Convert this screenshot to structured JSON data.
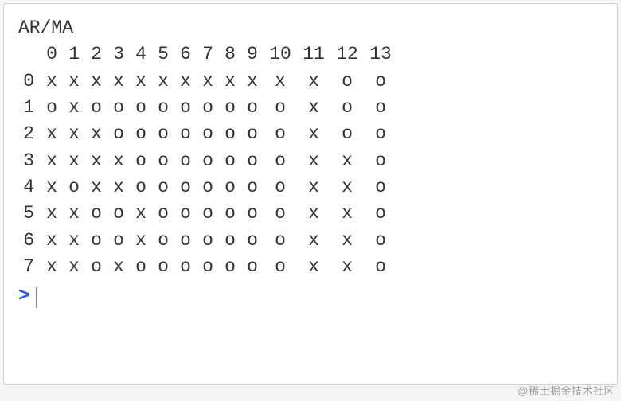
{
  "console": {
    "title": "AR/MA",
    "col_headers": [
      "0",
      "1",
      "2",
      "3",
      "4",
      "5",
      "6",
      "7",
      "8",
      "9",
      "10",
      "11",
      "12",
      "13"
    ],
    "rows": [
      {
        "label": "0",
        "cells": [
          "x",
          "x",
          "x",
          "x",
          "x",
          "x",
          "x",
          "x",
          "x",
          "x",
          "x",
          "x",
          "o",
          "o"
        ]
      },
      {
        "label": "1",
        "cells": [
          "o",
          "x",
          "o",
          "o",
          "o",
          "o",
          "o",
          "o",
          "o",
          "o",
          "o",
          "x",
          "o",
          "o"
        ]
      },
      {
        "label": "2",
        "cells": [
          "x",
          "x",
          "x",
          "o",
          "o",
          "o",
          "o",
          "o",
          "o",
          "o",
          "o",
          "x",
          "o",
          "o"
        ]
      },
      {
        "label": "3",
        "cells": [
          "x",
          "x",
          "x",
          "x",
          "o",
          "o",
          "o",
          "o",
          "o",
          "o",
          "o",
          "x",
          "x",
          "o"
        ]
      },
      {
        "label": "4",
        "cells": [
          "x",
          "o",
          "x",
          "x",
          "o",
          "o",
          "o",
          "o",
          "o",
          "o",
          "o",
          "x",
          "x",
          "o"
        ]
      },
      {
        "label": "5",
        "cells": [
          "x",
          "x",
          "o",
          "o",
          "x",
          "o",
          "o",
          "o",
          "o",
          "o",
          "o",
          "x",
          "x",
          "o"
        ]
      },
      {
        "label": "6",
        "cells": [
          "x",
          "x",
          "o",
          "o",
          "x",
          "o",
          "o",
          "o",
          "o",
          "o",
          "o",
          "x",
          "x",
          "o"
        ]
      },
      {
        "label": "7",
        "cells": [
          "x",
          "x",
          "o",
          "x",
          "o",
          "o",
          "o",
          "o",
          "o",
          "o",
          "o",
          "x",
          "x",
          "o"
        ]
      }
    ],
    "prompt_symbol": ">"
  },
  "watermark": "@稀土掘金技术社区"
}
